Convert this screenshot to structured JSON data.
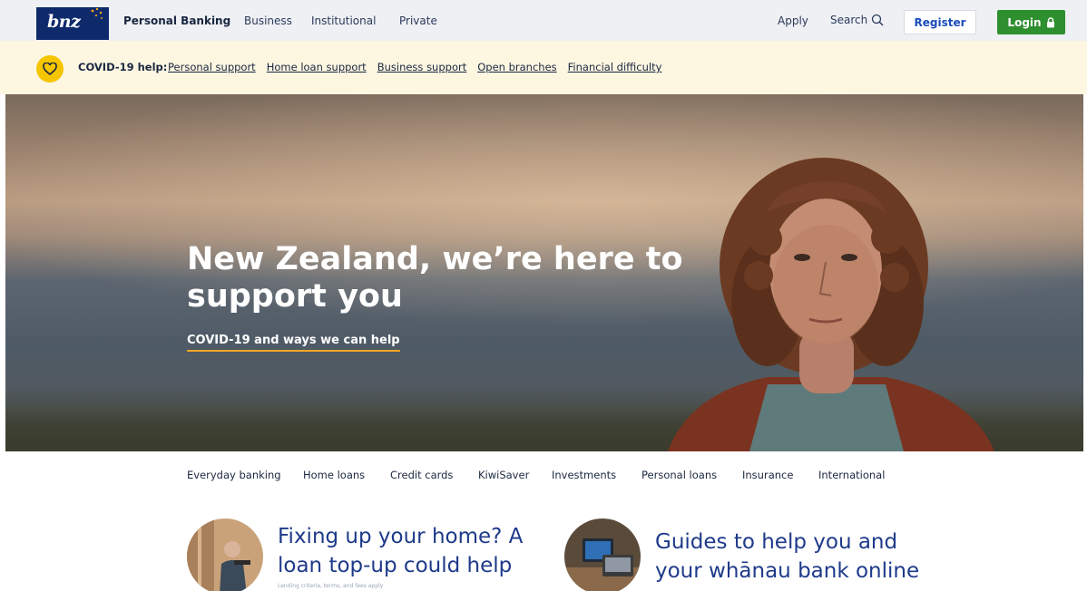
{
  "topnav": {
    "logo_text": "bnz",
    "segments": [
      "Personal Banking",
      "Business",
      "Institutional",
      "Private"
    ],
    "apply_label": "Apply",
    "search_label": "Search",
    "register_label": "Register",
    "login_label": "Login"
  },
  "covid": {
    "label": "COVID-19 help:",
    "links": [
      "Personal support",
      "Home loan support",
      "Business support",
      "Open branches",
      "Financial difficulty"
    ]
  },
  "hero": {
    "title": "New Zealand, we’re here to support you",
    "link": "COVID-19 and ways we can help"
  },
  "products": [
    "Everyday banking",
    "Home loans",
    "Credit cards",
    "KiwiSaver",
    "Investments",
    "Personal loans",
    "Insurance",
    "International"
  ],
  "promos": [
    {
      "title_line1": "Fixing up your home? A",
      "title_line2": "loan top-up could help",
      "note": "Lending criteria, terms, and fees apply"
    },
    {
      "title_line1": "Guides to help you and",
      "title_line2": "your whānau bank online"
    }
  ],
  "colors": {
    "navy": "#0e2a6b",
    "login_green": "#2e8f2e",
    "covid_bg": "#fdf6e1",
    "covid_yellow": "#f5c500",
    "hero_underline": "#f5a623",
    "promo_blue": "#1e3a8a"
  },
  "icons": [
    "bnz-stars-icon",
    "search-icon",
    "lock-icon",
    "heart-icon"
  ]
}
